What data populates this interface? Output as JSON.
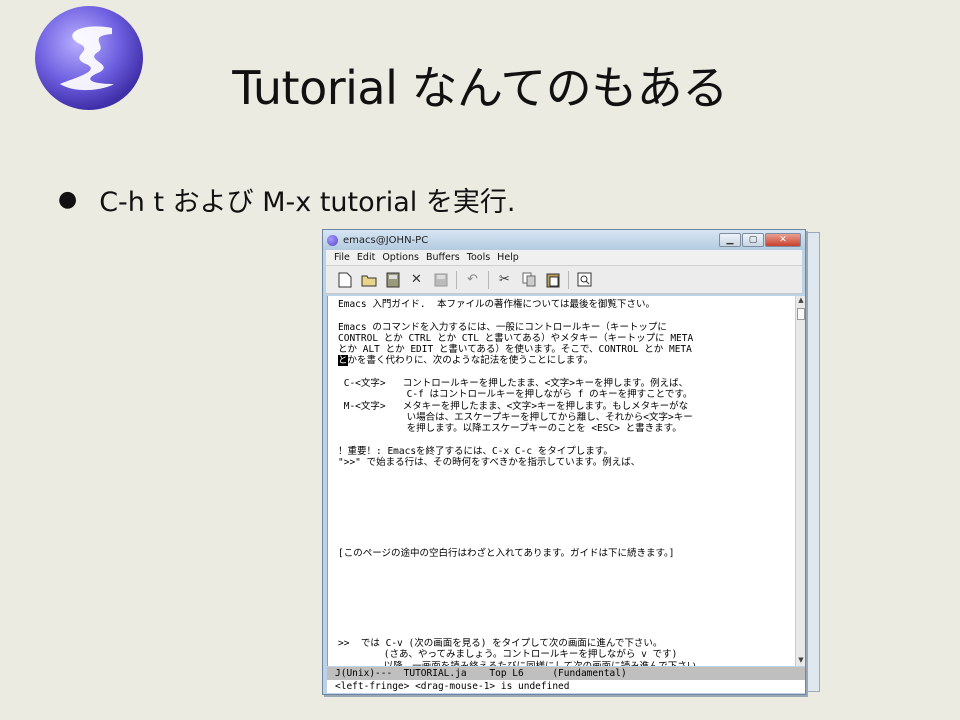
{
  "slide": {
    "title": "Tutorial なんてのもある",
    "bullet": "C-h t および M-x tutorial を実行."
  },
  "window": {
    "title": "emacs@JOHN-PC",
    "menu": [
      "File",
      "Edit",
      "Options",
      "Buffers",
      "Tools",
      "Help"
    ],
    "toolbar_icons": [
      "new-file-icon",
      "open-folder-icon",
      "save-file-icon",
      "close-x-icon",
      "save-disabled-icon",
      "undo-icon",
      "cut-icon",
      "copy-icon",
      "paste-icon",
      "search-icon"
    ],
    "buffer_lines": [
      "Emacs 入門ガイド.  本ファイルの著作権については最後を御覧下さい。",
      "",
      "Emacs のコマンドを入力するには、一般にコントロールキー（キートップに",
      "CONTROL とか CTRL とか CTL と書いてある）やメタキー（キートップに META",
      "とか ALT とか EDIT と書いてある）を使います。そこで、CONTROL とか META",
      "とかを書く代わりに、次のような記法を使うことにします。",
      "",
      " C-<文字>   コントロールキーを押したまま、<文字>キーを押します。例えば、",
      "            C-f はコントロールキーを押しながら f のキーを押すことです。",
      " M-<文字>   メタキーを押したまま、<文字>キーを押します。もしメタキーがな",
      "            い場合は、エスケープキーを押してから離し、それから<文字>キー",
      "            を押します。以降エスケープキーのことを <ESC> と書きます。",
      "",
      "！重要！: Emacsを終了するには、C-x C-c をタイプします。",
      "\">>\" で始まる行は、その時何をすべきかを指示しています。例えば、",
      "",
      "",
      "",
      "",
      "",
      "",
      "",
      "[このページの途中の空白行はわざと入れてあります。ガイドは下に続きます。]",
      "",
      "",
      "",
      "",
      "",
      "",
      "",
      ">>  では C-v (次の画面を見る) をタイプして次の画面に進んで下さい。",
      "        (さあ、やってみましょう。コントロールキーを押しながら v です)",
      "        以降、一画面を読み終えるたびに同様にして次の画面に読み進んで下さい。"
    ],
    "modeline": "J(Unix)---  TUTORIAL.ja    Top L6     (Fundamental)",
    "minibuffer": "<left-fringe> <drag-mouse-1> is undefined"
  },
  "colors": {
    "background": "#ecebe2",
    "window_frame": "#bcd3e6",
    "modeline": "#bfbfbf"
  }
}
